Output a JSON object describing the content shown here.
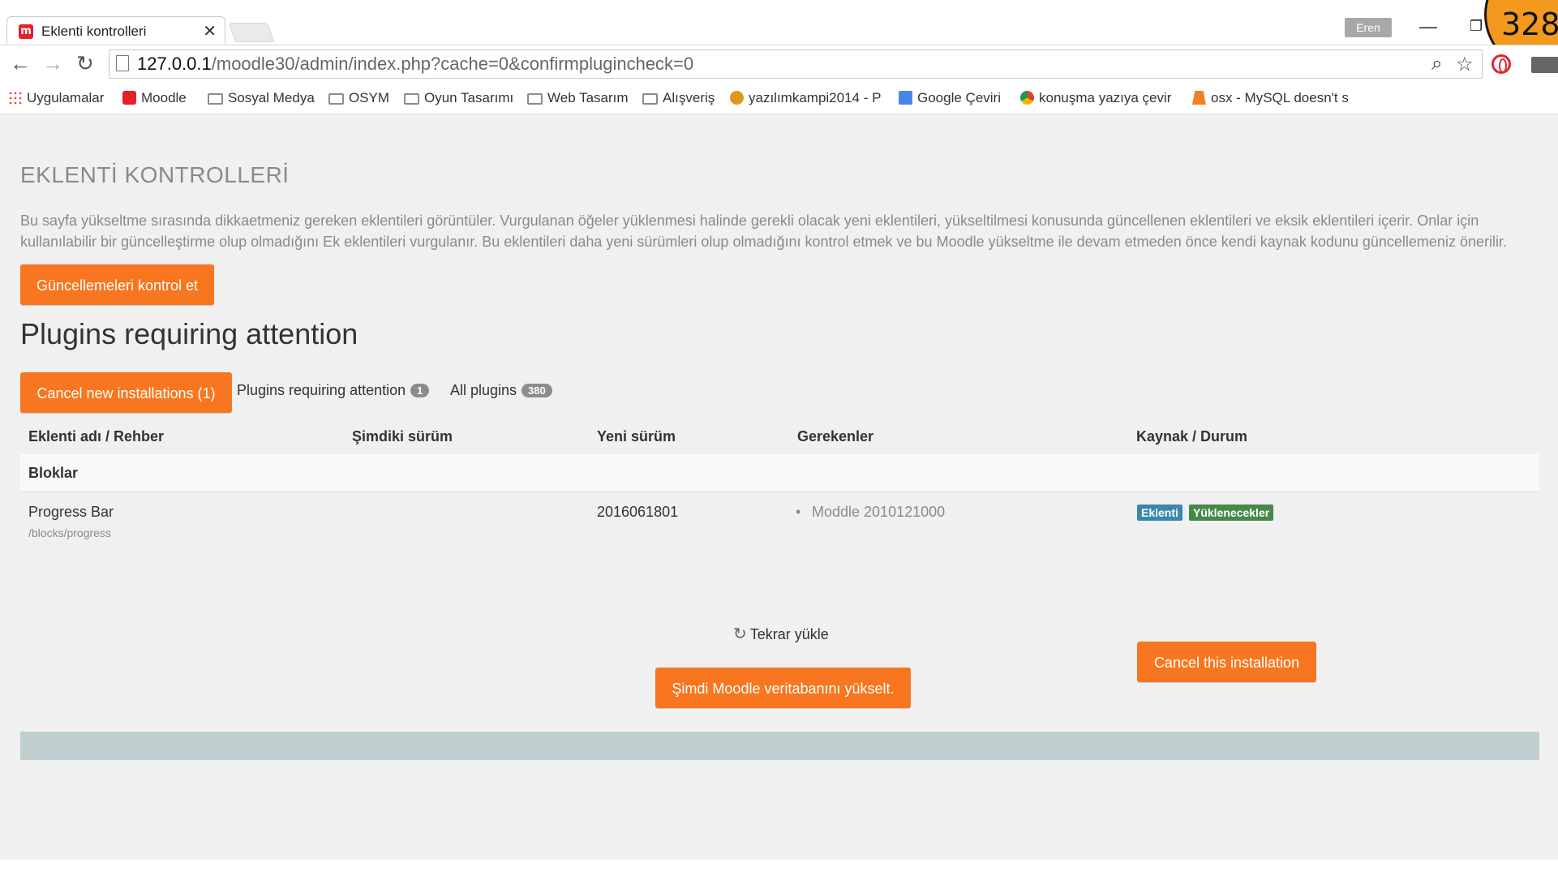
{
  "browser": {
    "tab_title": "Eklenti kontrolleri",
    "tab_favicon_letter": "m",
    "profile_name": "Eren",
    "corner_badge_number": "328",
    "url_host": "127.0.0.1",
    "url_path": "/moodle30/admin/index.php?cache=0&confirmplugincheck=0",
    "bookmarks": [
      {
        "label": "Uygulamalar",
        "icon": "apps-grid-icon"
      },
      {
        "label": "Moodle",
        "icon": "moodle-icon"
      },
      {
        "label": "Sosyal Medya",
        "icon": "folder-icon"
      },
      {
        "label": "OSYM",
        "icon": "folder-icon"
      },
      {
        "label": "Oyun Tasarımı",
        "icon": "folder-icon"
      },
      {
        "label": "Web Tasarım",
        "icon": "folder-icon"
      },
      {
        "label": "Alışveriş",
        "icon": "folder-icon"
      },
      {
        "label": "yazılımkampi2014 - P",
        "icon": "tiger-icon"
      },
      {
        "label": "Google Çeviri",
        "icon": "google-translate-icon"
      },
      {
        "label": "konuşma yazıya çevir",
        "icon": "chrome-icon"
      },
      {
        "label": "osx - MySQL doesn't s",
        "icon": "stackoverflow-icon"
      }
    ]
  },
  "page": {
    "heading": "EKLENTİ KONTROLLERİ",
    "intro": "Bu sayfa yükseltme sırasında dikkaetmeniz gereken eklentileri görüntüler. Vurgulanan öğeler yüklenmesi halinde gerekli olacak yeni eklentileri, yükseltilmesi konusunda güncellenen eklentileri ve eksik eklentileri içerir. Onlar için kullanılabilir bir güncelleştirme olup olmadığını Ek eklentileri vurgulanır. Bu eklentileri daha yeni sürümleri olup olmadığını kontrol etmek ve bu Moodle yükseltme ile devam etmeden önce kendi kaynak kodunu güncellemeniz önerilir.",
    "check_updates_button": "Güncellemeleri kontrol et",
    "plugins_heading": "Plugins requiring attention",
    "cancel_new_button": "Cancel new installations (1)",
    "filters": {
      "attention_label": "Plugins requiring attention",
      "attention_count": "1",
      "all_label": "All plugins",
      "all_count": "380"
    },
    "table": {
      "headers": [
        "Eklenti adı / Rehber",
        "Şimdiki sürüm",
        "Yeni sürüm",
        "Gerekenler",
        "Kaynak / Durum"
      ],
      "group": "Bloklar",
      "row": {
        "name": "Progress Bar",
        "path": "/blocks/progress",
        "current_version": "",
        "new_version": "2016061801",
        "requirement": "Moddle 2010121000",
        "badge_source": "Eklenti",
        "badge_status": "Yüklenecekler",
        "cancel_button": "Cancel this installation"
      }
    },
    "reload_label": "Tekrar yükle",
    "upgrade_button": "Şimdi Moodle veritabanını yükselt."
  },
  "colors": {
    "accent": "#f7761f",
    "badge_blue": "#3a87ad",
    "badge_green": "#468847",
    "footer_bar": "#bfcfd0"
  }
}
